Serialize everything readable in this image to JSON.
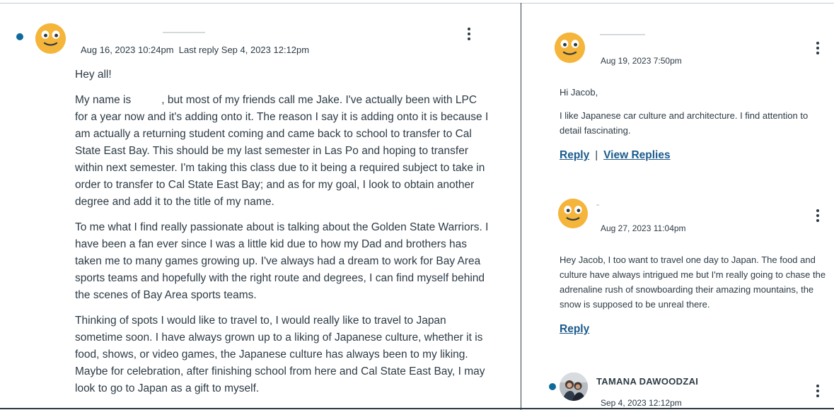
{
  "main_post": {
    "date": "Aug 16, 2023 10:24pm",
    "last_reply": "Last reply Sep 4, 2023 12:12pm",
    "greeting": "Hey all!",
    "paragraphs": [
      "My name is          , but most of my friends call me Jake. I've actually been with LPC for a year now and it's adding onto it. The reason I say it is adding onto it is because I am actually a returning student coming and came back to school to transfer to Cal State East Bay. This should be my last semester in Las Po and hoping to transfer within next semester. I'm taking this class due to it being a required subject to take in order to transfer to Cal State East Bay; and as for my goal, I look to obtain another degree and add it to the title of my name.",
      "To me what I find really passionate about is talking about the Golden State Warriors. I have been a fan ever since I was a little kid due to how my Dad and brothers has taken me to many games growing up. I've always had a dream to work for Bay Area sports teams and hopefully with the right route and degrees, I can find myself behind the scenes of Bay Area sports teams.",
      "Thinking of spots I would like to travel to, I would really like to travel to Japan sometime soon. I have always grown up to a liking of Japanese culture, whether it is food, shows, or video games, the Japanese culture has always been to my liking. Maybe for celebration, after finishing school from here and Cal State East Bay, I may look to go to Japan as a gift to myself."
    ]
  },
  "replies": [
    {
      "date": "Aug 19, 2023 7:50pm",
      "paragraphs": [
        "Hi Jacob,",
        "I like Japanese car culture and architecture. I find attention to detail fascinating."
      ],
      "reply_link": "Reply",
      "separator": "|",
      "view_replies_link": "View Replies"
    },
    {
      "date": "Aug 27, 2023 11:04pm",
      "paragraphs": [
        "Hey Jacob, I too want to travel one day to Japan. The food and culture have always intrigued me but I'm really going to chase the adrenaline rush of snowboarding their amazing mountains, the snow is supposed to be unreal there."
      ],
      "reply_link": "Reply"
    },
    {
      "author": "TAMANA DAWOODZAI",
      "date": "Sep 4, 2023 12:12pm"
    }
  ],
  "colors": {
    "text": "#2d3b45",
    "link": "#1a5a8c",
    "unread_dot": "#0e6a9b",
    "avatar": "#f5b43a"
  },
  "icons": {
    "avatar": "smiley-face-avatar-icon",
    "menu": "kebab-menu-icon",
    "unread": "unread-dot-icon"
  }
}
